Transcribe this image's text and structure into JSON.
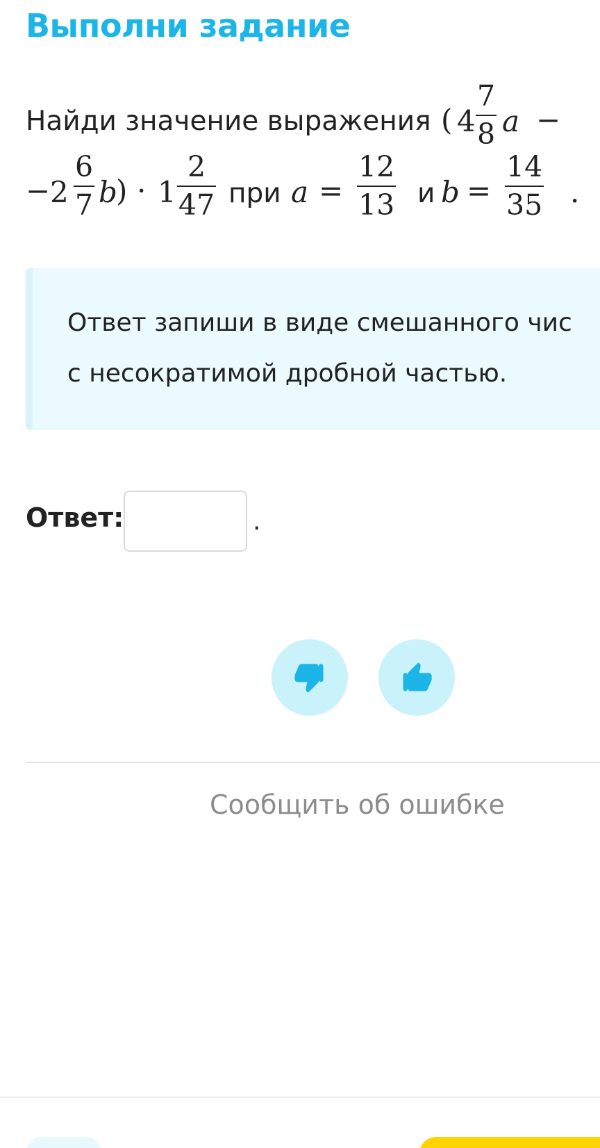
{
  "title": "Выполни задание",
  "statement": {
    "lead_text": "Найди значение выражения",
    "open_paren": "(",
    "whole1": "4",
    "frac1": {
      "num": "7",
      "den": "8"
    },
    "var_a": "a",
    "minus_end": "−",
    "minus_start": "−",
    "whole2": "2",
    "frac2": {
      "num": "6",
      "den": "7"
    },
    "var_b": "b",
    "close_paren": ")",
    "dot_op": "·",
    "whole3": "1",
    "frac3": {
      "num": "2",
      "den": "47"
    },
    "at_text": "при",
    "a_eq_var": "a",
    "eq1": "=",
    "frac_a": {
      "num": "12",
      "den": "13"
    },
    "and_text": "и",
    "b_eq_var": "b",
    "eq2": "=",
    "frac_b": {
      "num": "14",
      "den": "35"
    },
    "end_period": "."
  },
  "hint": {
    "line1": "Ответ запиши в виде смешанного чис",
    "line2": "с несократимой дробной частью."
  },
  "answer": {
    "label": "Ответ:",
    "value": "",
    "trailing_period": "."
  },
  "feedback": {
    "dislike_icon": "thumbs-down-icon",
    "like_icon": "thumbs-up-icon",
    "icon_color": "#1cb5e8",
    "button_color": "#c9f2fb"
  },
  "report_link": "Сообщить об ошибке",
  "colors": {
    "accent": "#1cb5e8",
    "hint_bg": "#eafafd",
    "primary_button": "#ffd400"
  }
}
